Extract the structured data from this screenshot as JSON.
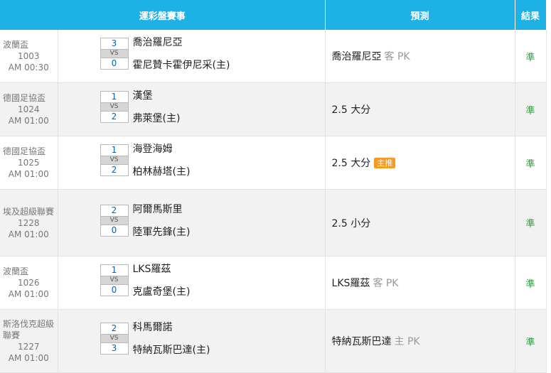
{
  "header": {
    "event_label": "運彩盤賽事",
    "prediction_label": "預測",
    "result_label": "結果"
  },
  "rows": [
    {
      "league": "波蘭盃",
      "num": "1003",
      "time": "AM 00:30",
      "away_score": "3",
      "home_score": "0",
      "vs": "VS",
      "away_team": "喬治羅尼亞",
      "home_team": "霍尼贊卡霍伊尼采(主)",
      "prediction": "喬治羅尼亞",
      "prediction_side": "客 PK",
      "badge": "",
      "result": "準"
    },
    {
      "league": "德國足協盃",
      "num": "1024",
      "time": "AM 01:00",
      "away_score": "1",
      "home_score": "2",
      "vs": "VS",
      "away_team": "漢堡",
      "home_team": "弗萊堡(主)",
      "prediction": "2.5 大分",
      "prediction_side": "",
      "badge": "",
      "result": "準"
    },
    {
      "league": "德國足協盃",
      "num": "1025",
      "time": "AM 01:00",
      "away_score": "1",
      "home_score": "2",
      "vs": "VS",
      "away_team": "海登海姆",
      "home_team": "柏林赫塔(主)",
      "prediction": "2.5 大分",
      "prediction_side": "",
      "badge": "主推",
      "result": "準"
    },
    {
      "league": "埃及超級聯賽",
      "num": "1228",
      "time": "AM 01:00",
      "away_score": "2",
      "home_score": "0",
      "vs": "VS",
      "away_team": "阿爾馬斯里",
      "home_team": "陸軍先鋒(主)",
      "prediction": "2.5 小分",
      "prediction_side": "",
      "badge": "",
      "result": "準"
    },
    {
      "league": "波蘭盃",
      "num": "1026",
      "time": "AM 01:00",
      "away_score": "1",
      "home_score": "0",
      "vs": "VS",
      "away_team": "LKS羅茲",
      "home_team": "克盧奇堡(主)",
      "prediction": "LKS羅茲",
      "prediction_side": "客 PK",
      "badge": "",
      "result": "準"
    },
    {
      "league": "斯洛伐克超級聯賽",
      "num": "1227",
      "time": "AM 01:00",
      "away_score": "2",
      "home_score": "3",
      "vs": "VS",
      "away_team": "科馬爾諾",
      "home_team": "特納瓦斯巴達(主)",
      "prediction": "特納瓦斯巴達",
      "prediction_side": "主 PK",
      "badge": "",
      "result": "準"
    }
  ]
}
